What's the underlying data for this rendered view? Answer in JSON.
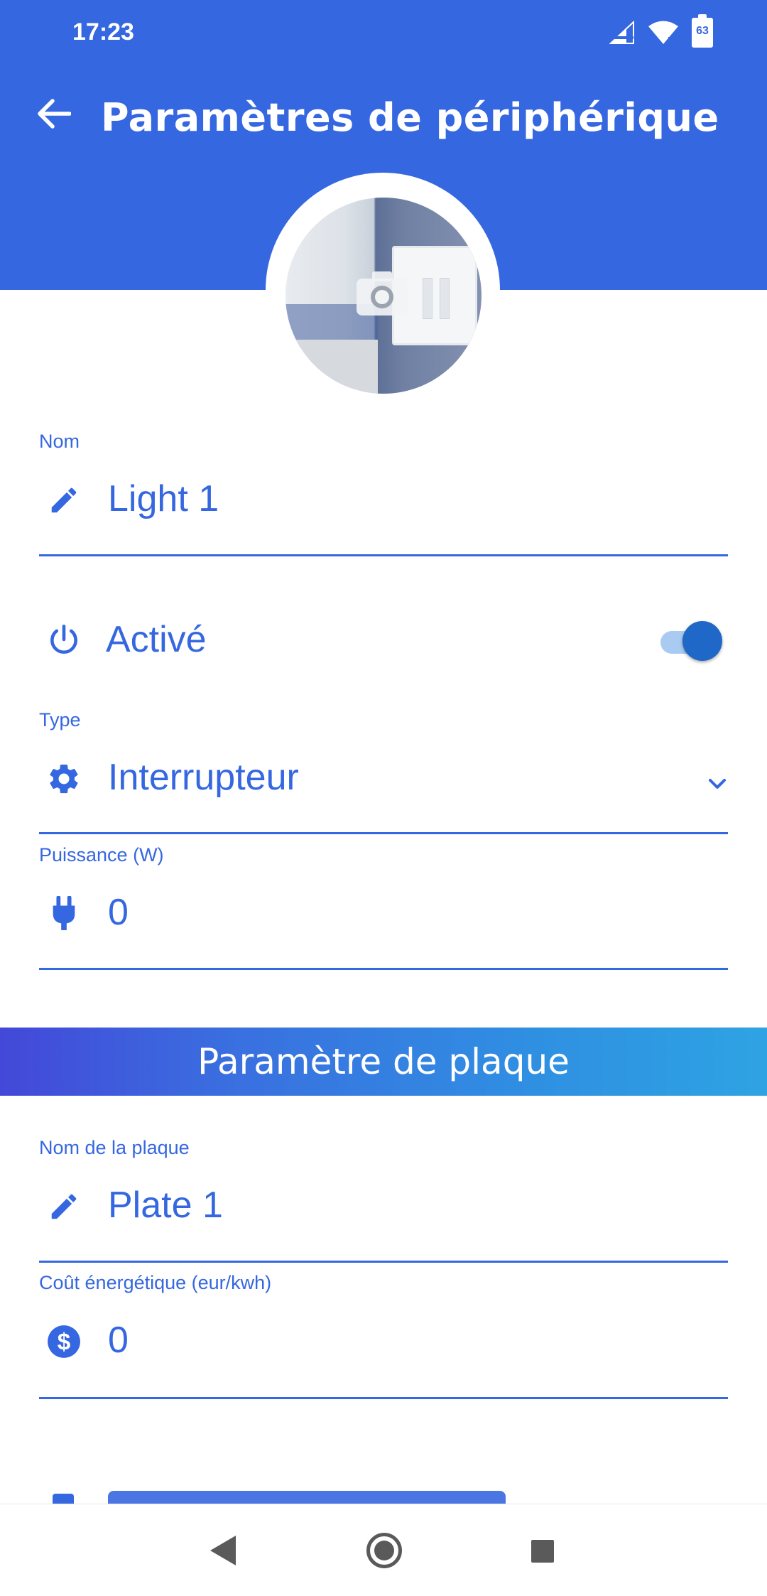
{
  "status_bar": {
    "time": "17:23",
    "battery_level": "63"
  },
  "app_bar": {
    "title": "Paramètres de périphérique",
    "back_icon": "arrow-left-icon"
  },
  "device_image": {
    "badge_icon": "camera-icon"
  },
  "fields": {
    "name": {
      "label": "Nom",
      "value": "Light 1",
      "icon": "pencil-icon"
    },
    "active": {
      "label": "Activé",
      "enabled": true,
      "icon": "power-icon"
    },
    "type": {
      "label": "Type",
      "value": "Interrupteur",
      "icon": "gear-icon"
    },
    "power": {
      "label": "Puissance (W)",
      "value": "0",
      "icon": "plug-icon"
    }
  },
  "plate_section": {
    "title": "Paramètre de plaque",
    "plate_name": {
      "label": "Nom de la plaque",
      "value": "Plate 1",
      "icon": "pencil-icon"
    },
    "energy_cost": {
      "label": "Coût énergétique (eur/kwh)",
      "value": "0",
      "icon": "dollar-circle-icon"
    }
  },
  "colors": {
    "primary": "#3567e0",
    "toggle_thumb": "#1f68c8",
    "toggle_track": "#a9cbf2",
    "banner_start": "#4348d8",
    "banner_end": "#2ea3e3"
  }
}
